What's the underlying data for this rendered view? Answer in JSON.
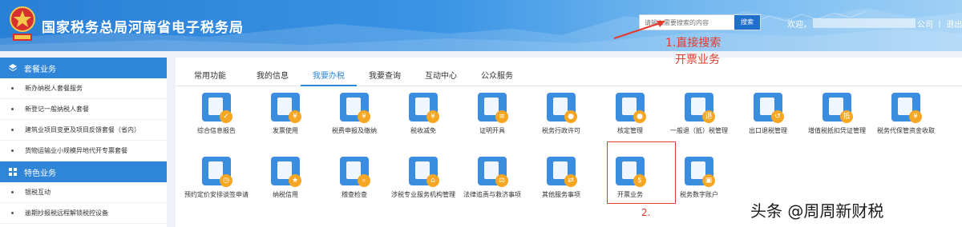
{
  "header": {
    "title": "国家税务总局河南省电子税务局",
    "search_placeholder": "请输入需要搜索的内容",
    "search_button": "搜索",
    "welcome": "欢迎，",
    "user_tail": "公司 丨 退出"
  },
  "annotations": {
    "step1_line1": "1.直接搜索",
    "step1_line2": "开票业务",
    "step2": "2.",
    "watermark": "头条 @周周新财税",
    "color": "#e53a2e"
  },
  "sidebar": {
    "sections": [
      {
        "title": "套餐业务",
        "icon": "layers-icon",
        "items": [
          "新办纳税人套餐服务",
          "新登记一般纳税人套餐",
          "建筑业项目变更及项目反馈套餐（省内）",
          "货物运输业小规模异地代开专票套餐"
        ]
      },
      {
        "title": "特色业务",
        "icon": "grid-icon",
        "items": [
          "银税互动",
          "逾期抄报税远程解锁税控设备"
        ]
      }
    ]
  },
  "tabs": [
    "常用功能",
    "我的信息",
    "我要办税",
    "我要查询",
    "互动中心",
    "公众服务"
  ],
  "active_tab": "我要办税",
  "services": [
    {
      "label": "综合信息报告",
      "icon": "monitor-check-icon"
    },
    {
      "label": "发票使用",
      "icon": "invoice-pen-icon"
    },
    {
      "label": "税费申报及缴纳",
      "icon": "document-yen-icon"
    },
    {
      "label": "税收减免",
      "icon": "folder-yen-icon"
    },
    {
      "label": "证明开具",
      "icon": "document-icon"
    },
    {
      "label": "税务行政许可",
      "icon": "id-card-icon"
    },
    {
      "label": "核定管理",
      "icon": "briefcase-person-icon"
    },
    {
      "label": "一般退（抵）税管理",
      "icon": "refund-tag-icon"
    },
    {
      "label": "出口退税管理",
      "icon": "export-refund-icon"
    },
    {
      "label": "增值税抵扣凭证管理",
      "icon": "deduction-tag-icon"
    },
    {
      "label": "税务代保管资金收取",
      "icon": "money-pen-icon"
    },
    {
      "label": "预约定价安排谈签申请",
      "icon": "calendar-clock-icon"
    },
    {
      "label": "纳税信用",
      "icon": "star-badge-icon"
    },
    {
      "label": "稽查检查",
      "icon": "magnifier-document-icon"
    },
    {
      "label": "涉税专业服务机构管理",
      "icon": "building-icon"
    },
    {
      "label": "法律追责与救济事项",
      "icon": "gavel-icon"
    },
    {
      "label": "其他服务事项",
      "icon": "signpost-icon"
    },
    {
      "label": "开票业务",
      "icon": "invoice-ribbon-icon"
    },
    {
      "label": "税务数字账户",
      "icon": "digital-account-icon"
    }
  ],
  "colors": {
    "primary": "#2f86d8",
    "icon_blue": "#3b8de0",
    "icon_orange": "#f5a623",
    "annotation_red": "#e53a2e"
  }
}
